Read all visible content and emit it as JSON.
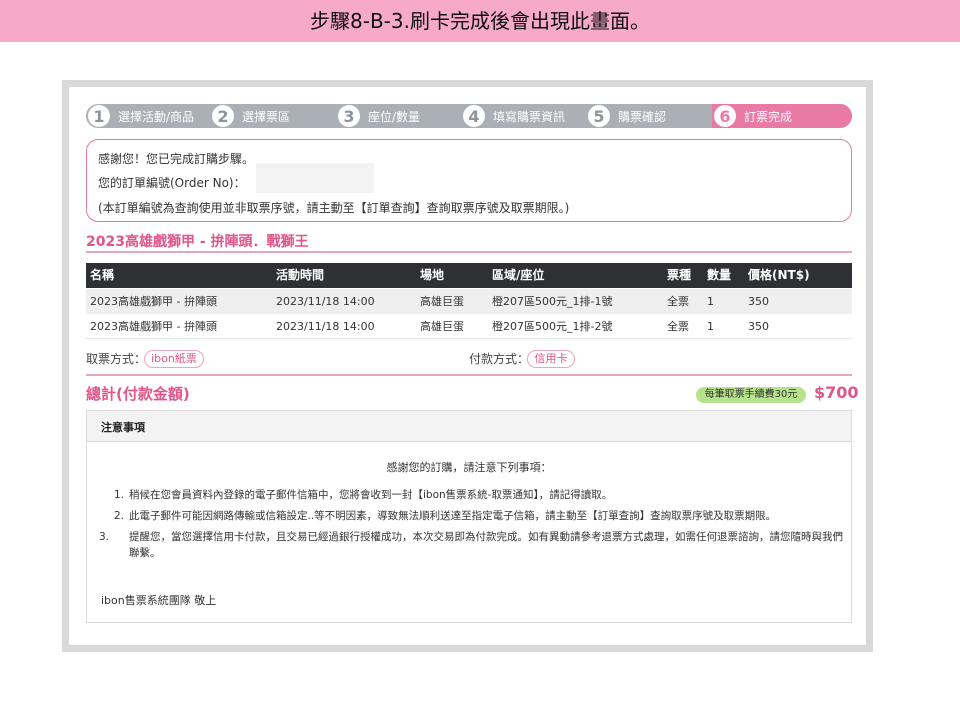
{
  "slide_title": "步驟8-B-3.刷卡完成後會出現此畫面。",
  "steps": [
    {
      "num": "1",
      "label": "選擇活動/商品"
    },
    {
      "num": "2",
      "label": "選擇票區"
    },
    {
      "num": "3",
      "label": "座位/數量"
    },
    {
      "num": "4",
      "label": "填寫購票資訊"
    },
    {
      "num": "5",
      "label": "購票確認"
    },
    {
      "num": "6",
      "label": "訂票完成"
    }
  ],
  "notice": {
    "thanks": "感謝您！您已完成訂購步驟。",
    "order_no_label": "您的訂單編號(Order  No)：",
    "order_note": "(本訂單編號為查詢使用並非取票序號，請主動至【訂單查詢】查詢取票序號及取票期限。)"
  },
  "event_title": "2023高雄戲獅甲 - 拚陣頭．戰獅王",
  "table": {
    "headers": [
      "名稱",
      "活動時間",
      "場地",
      "區域/座位",
      "票種",
      "數量",
      "價格(NT$)"
    ],
    "rows": [
      [
        "2023高雄戲獅甲 - 拚陣頭",
        "2023/11/18  14:00",
        "高雄巨蛋",
        "橙207區500元_1排-1號",
        "全票",
        "1",
        "350"
      ],
      [
        "2023高雄戲獅甲 - 拚陣頭",
        "2023/11/18  14:00",
        "高雄巨蛋",
        "橙207區500元_1排-2號",
        "全票",
        "1",
        "350"
      ]
    ]
  },
  "pickup": {
    "label": "取票方式：",
    "value": "ibon紙票"
  },
  "payment": {
    "label": "付款方式：",
    "value": "信用卡"
  },
  "total": {
    "label": "總計(付款金額)",
    "fee_note": "每筆取票手續費30元",
    "amount": "$700"
  },
  "notes": {
    "title": "注意事項",
    "thanks": "感謝您的訂購，請注意下列事項：",
    "items": [
      {
        "n": "1.",
        "text": "稍候在您會員資料內登錄的電子郵件信箱中，您將會收到一封【ibon售票系統-取票通知】，請記得讀取。"
      },
      {
        "n": "2.",
        "text": "此電子郵件可能因網路傳輸或信箱設定..等不明因素，導致無法順利送達至指定電子信箱，請主動至【訂單查詢】查詢取票序號及取票期限。"
      },
      {
        "n": "3.",
        "text": "提醒您，當您選擇信用卡付款，且交易已經過銀行授權成功，本次交易即為付款完成。如有異動請參考退票方式處理，如需任何退票諮詢，請您隨時與我們聯繫。"
      }
    ],
    "signature": "ibon售票系統團隊  敬上"
  },
  "colors": {
    "banner": "#f6a9c9",
    "accent": "#e0558b",
    "step_bar": "#aab0b5",
    "step_active": "#e97aa6",
    "table_head": "#2f3033",
    "fee_badge": "#b6e38a"
  }
}
